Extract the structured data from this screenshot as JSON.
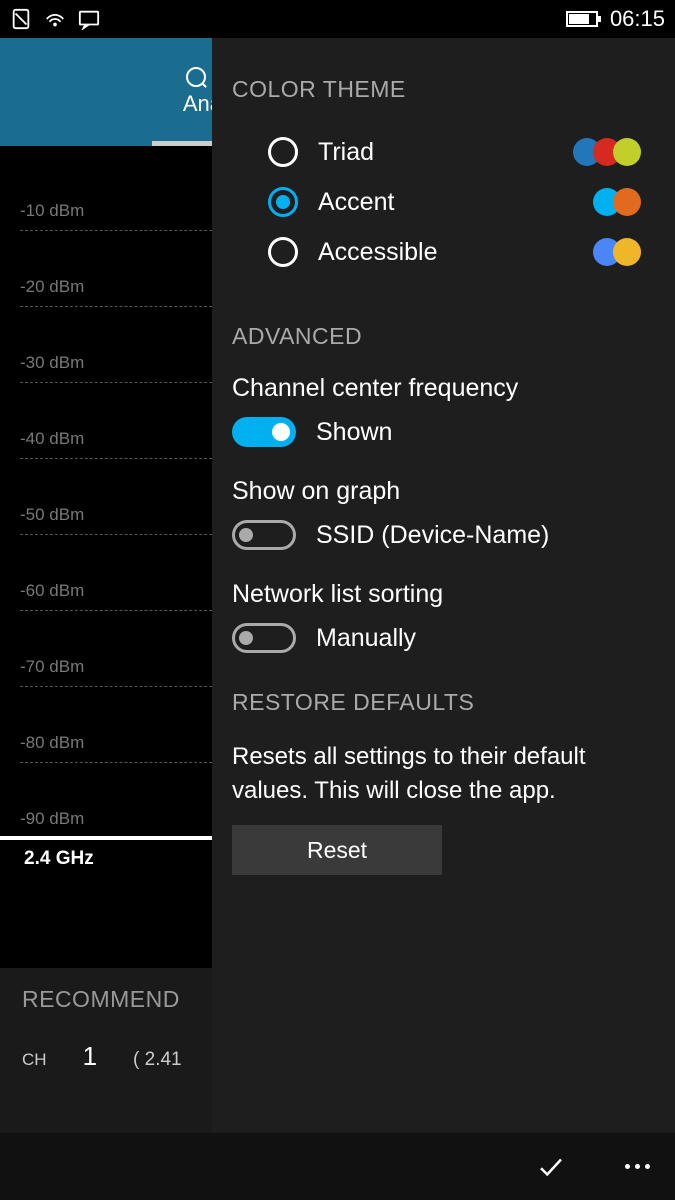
{
  "status_bar": {
    "time": "06:15"
  },
  "background": {
    "header_tab": "Ana",
    "band_label": "2.4 GHz",
    "recommend_title": "RECOMMEND",
    "recommend_ch_label": "CH",
    "recommend_ch_value": "1",
    "recommend_freq": "( 2.41"
  },
  "chart_data": {
    "type": "line",
    "title": "",
    "ylabel": "dBm",
    "y_ticks": [
      "-10 dBm",
      "-20 dBm",
      "-30 dBm",
      "-40 dBm",
      "-50 dBm",
      "-60 dBm",
      "-70 dBm",
      "-80 dBm",
      "-90 dBm"
    ],
    "ylim": [
      -90,
      -10
    ],
    "series": []
  },
  "settings": {
    "color_theme": {
      "title": "COLOR THEME",
      "options": [
        {
          "label": "Triad",
          "selected": false,
          "colors": [
            "#2277bb",
            "#d6291f",
            "#c2cf2a"
          ]
        },
        {
          "label": "Accent",
          "selected": true,
          "colors": [
            "#00b0f0",
            "#e06a1e"
          ]
        },
        {
          "label": "Accessible",
          "selected": false,
          "colors": [
            "#4a86f7",
            "#f0b62a"
          ]
        }
      ]
    },
    "advanced": {
      "title": "ADVANCED",
      "channel_freq_label": "Channel center frequency",
      "channel_freq_value": "Shown",
      "channel_freq_on": true,
      "show_graph_label": "Show on graph",
      "show_graph_value": "SSID (Device-Name)",
      "show_graph_on": false,
      "sort_label": "Network list sorting",
      "sort_value": "Manually",
      "sort_on": false
    },
    "restore": {
      "title": "RESTORE DEFAULTS",
      "description": "Resets all settings to their default values. This will close the app.",
      "button": "Reset"
    }
  }
}
